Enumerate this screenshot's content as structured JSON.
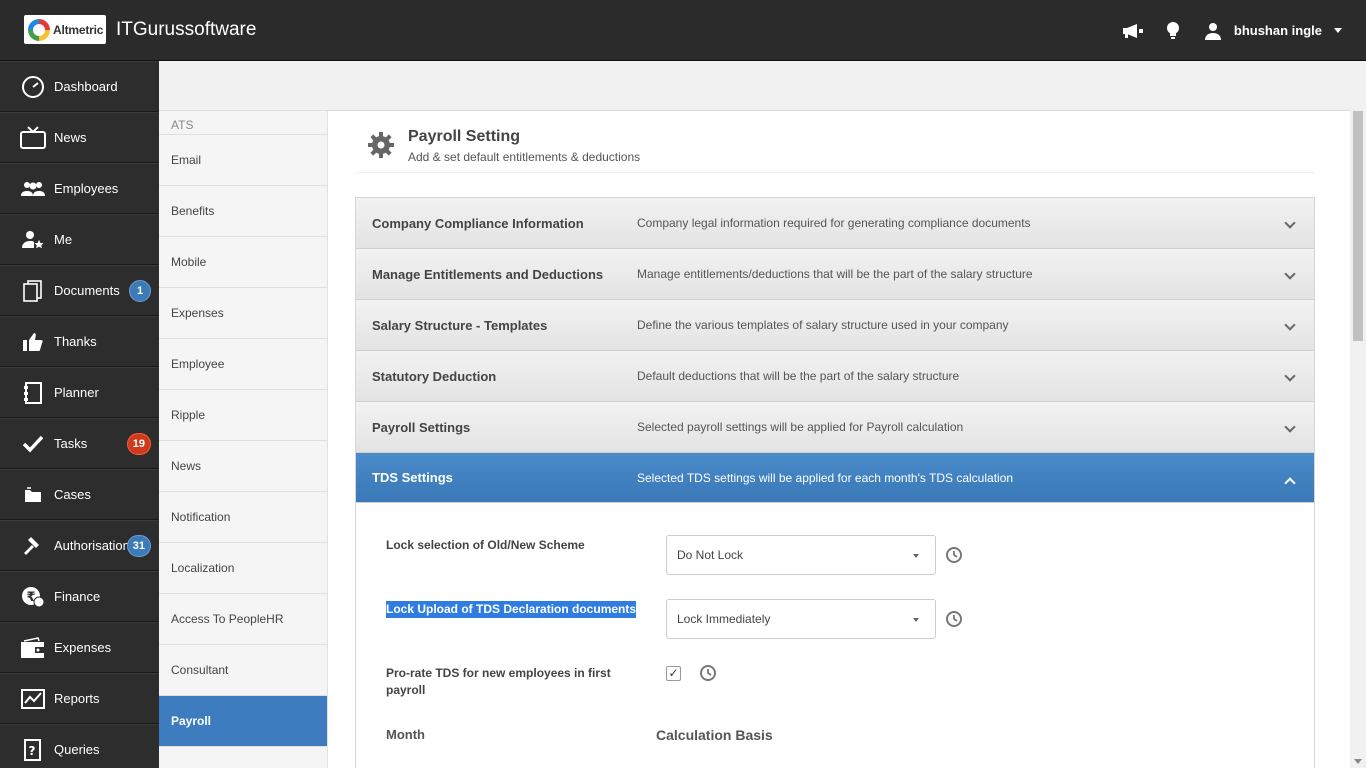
{
  "header": {
    "logo_text": "Altmetric",
    "company": "ITGurussoftware",
    "user_name": "bhushan ingle"
  },
  "sidebar": {
    "items": [
      {
        "label": "Dashboard",
        "icon": "dashboard-icon"
      },
      {
        "label": "News",
        "icon": "tv-icon"
      },
      {
        "label": "Employees",
        "icon": "people-icon"
      },
      {
        "label": "Me",
        "icon": "user-star-icon"
      },
      {
        "label": "Documents",
        "icon": "documents-icon",
        "badge": "1"
      },
      {
        "label": "Thanks",
        "icon": "thumbs-up-icon"
      },
      {
        "label": "Planner",
        "icon": "planner-icon"
      },
      {
        "label": "Tasks",
        "icon": "check-icon",
        "badge": "19"
      },
      {
        "label": "Cases",
        "icon": "folder-icon"
      },
      {
        "label": "Authorisations",
        "icon": "gavel-icon",
        "badge": "31"
      },
      {
        "label": "Finance",
        "icon": "rupee-icon"
      },
      {
        "label": "Expenses",
        "icon": "wallet-icon"
      },
      {
        "label": "Reports",
        "icon": "chart-icon"
      },
      {
        "label": "Queries",
        "icon": "question-icon"
      }
    ]
  },
  "subsidebar": {
    "partial_label": "ATS",
    "items": [
      "Email",
      "Benefits",
      "Mobile",
      "Expenses",
      "Employee",
      "Ripple",
      "News",
      "Notification",
      "Localization",
      "Access To PeopleHR",
      "Consultant",
      "Payroll"
    ],
    "active": "Payroll"
  },
  "page": {
    "title": "Payroll Setting",
    "subtitle": "Add & set default entitlements & deductions"
  },
  "accordion": [
    {
      "title": "Company Compliance Information",
      "desc": "Company legal information required for generating compliance documents"
    },
    {
      "title": "Manage Entitlements and Deductions",
      "desc": "Manage entitlements/deductions that will be the part of the salary structure"
    },
    {
      "title": "Salary Structure - Templates",
      "desc": "Define the various templates of salary structure used in your company"
    },
    {
      "title": "Statutory Deduction",
      "desc": "Default deductions that will be the part of the salary structure"
    },
    {
      "title": "Payroll Settings",
      "desc": "Selected payroll settings will be applied for Payroll calculation"
    },
    {
      "title": "TDS Settings",
      "desc": "Selected TDS settings will be applied for each month's TDS calculation"
    }
  ],
  "tds": {
    "lock_scheme_label": "Lock selection of Old/New Scheme",
    "lock_scheme_value": "Do Not Lock",
    "lock_upload_label": "Lock Upload of TDS Declaration documents",
    "lock_upload_value": "Lock Immediately",
    "prorate_label_1": "Pro-rate TDS for new employees in first",
    "prorate_label_2": "payroll",
    "prorate_checked": "✓",
    "month_header": "Month",
    "basis_header": "Calculation Basis"
  }
}
